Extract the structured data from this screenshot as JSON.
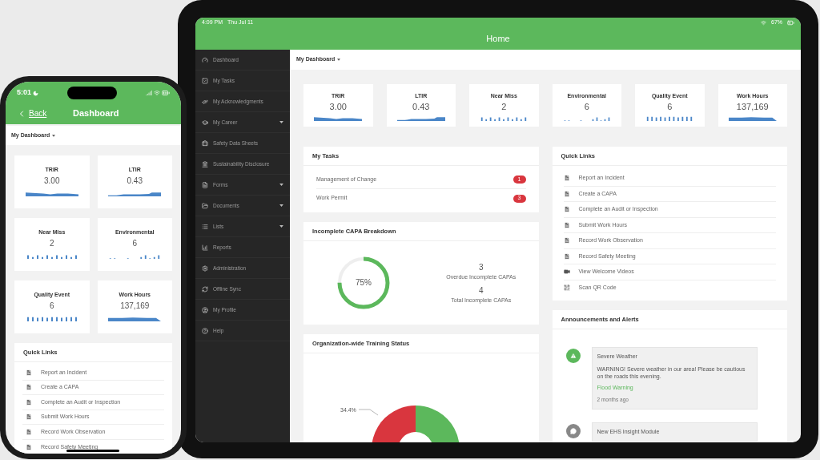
{
  "tablet": {
    "time": "4:09 PM",
    "date": "Thu Jul 11",
    "battery": "67%",
    "title": "Home",
    "sidebar": [
      {
        "label": "Dashboard",
        "expandable": false
      },
      {
        "label": "My Tasks",
        "expandable": false
      },
      {
        "label": "My Acknowledgments",
        "expandable": false
      },
      {
        "label": "My Career",
        "expandable": true
      },
      {
        "label": "Safety Data Sheets",
        "expandable": false
      },
      {
        "label": "Sustainability Disclosure",
        "expandable": false
      },
      {
        "label": "Forms",
        "expandable": true
      },
      {
        "label": "Documents",
        "expandable": true
      },
      {
        "label": "Lists",
        "expandable": true
      },
      {
        "label": "Reports",
        "expandable": false
      },
      {
        "label": "Administration",
        "expandable": false
      },
      {
        "label": "Offline Sync",
        "expandable": false
      },
      {
        "label": "My Profile",
        "expandable": false
      },
      {
        "label": "Help",
        "expandable": false
      }
    ],
    "dashboard_menu": "My Dashboard",
    "kpis": [
      {
        "label": "TRIR",
        "value": "3.00",
        "kind": "area"
      },
      {
        "label": "LTIR",
        "value": "0.43",
        "kind": "area"
      },
      {
        "label": "Near Miss",
        "value": "2",
        "kind": "bars"
      },
      {
        "label": "Environmental",
        "value": "6",
        "kind": "bars"
      },
      {
        "label": "Quality Event",
        "value": "6",
        "kind": "bars"
      },
      {
        "label": "Work Hours",
        "value": "137,169",
        "kind": "area"
      }
    ],
    "tasks": {
      "title": "My Tasks",
      "items": [
        {
          "label": "Management of Change",
          "count": "1"
        },
        {
          "label": "Work Permit",
          "count": "3"
        }
      ]
    },
    "capa": {
      "title": "Incomplete CAPA Breakdown",
      "percent": "75%",
      "level": 0.75,
      "stats": [
        {
          "value": "3",
          "label": "Overdue Incomplete CAPAs"
        },
        {
          "value": "4",
          "label": "Total Incomplete CAPAs"
        }
      ]
    },
    "training": {
      "title": "Organization-wide Training Status",
      "chart_data": {
        "type": "donut",
        "values": [
          34.4,
          65.6
        ],
        "annotations": [
          "34.4%"
        ]
      }
    },
    "quick_links": {
      "title": "Quick Links",
      "items": [
        {
          "label": "Report an Incident",
          "kind": "form"
        },
        {
          "label": "Create a CAPA",
          "kind": "form"
        },
        {
          "label": "Complete an Audit or Inspection",
          "kind": "form"
        },
        {
          "label": "Submit Work Hours",
          "kind": "form"
        },
        {
          "label": "Record Work Observation",
          "kind": "form"
        },
        {
          "label": "Record Safety Meeting",
          "kind": "form"
        },
        {
          "label": "View Welcome Videos",
          "kind": "video"
        },
        {
          "label": "Scan QR Code",
          "kind": "qr"
        }
      ]
    },
    "announcements": {
      "title": "Announcements and Alerts",
      "items": [
        {
          "kind": "alert",
          "title": "Severe Weather",
          "body": "WARNING! Severe weather in our area! Please be cautious on the roads this evening.",
          "link": "Flood Warning",
          "time": "2 months ago"
        },
        {
          "kind": "message",
          "title": "New EHS Insight Module"
        }
      ]
    }
  },
  "phone": {
    "time": "5:01",
    "back": "Back",
    "title": "Dashboard",
    "dashboard_menu": "My Dashboard",
    "kpis": [
      {
        "label": "TRIR",
        "value": "3.00",
        "kind": "area"
      },
      {
        "label": "LTIR",
        "value": "0.43",
        "kind": "area"
      },
      {
        "label": "Near Miss",
        "value": "2",
        "kind": "bars"
      },
      {
        "label": "Environmental",
        "value": "6",
        "kind": "bars"
      },
      {
        "label": "Quality Event",
        "value": "6",
        "kind": "bars"
      },
      {
        "label": "Work Hours",
        "value": "137,169",
        "kind": "area"
      }
    ],
    "quick_links": {
      "title": "Quick Links",
      "items": [
        {
          "label": "Report an Incident",
          "kind": "form"
        },
        {
          "label": "Create a CAPA",
          "kind": "form"
        },
        {
          "label": "Complete an Audit or Inspection",
          "kind": "form"
        },
        {
          "label": "Submit Work Hours",
          "kind": "form"
        },
        {
          "label": "Record Work Observation",
          "kind": "form"
        },
        {
          "label": "Record Safety Meeting",
          "kind": "form"
        }
      ]
    }
  }
}
